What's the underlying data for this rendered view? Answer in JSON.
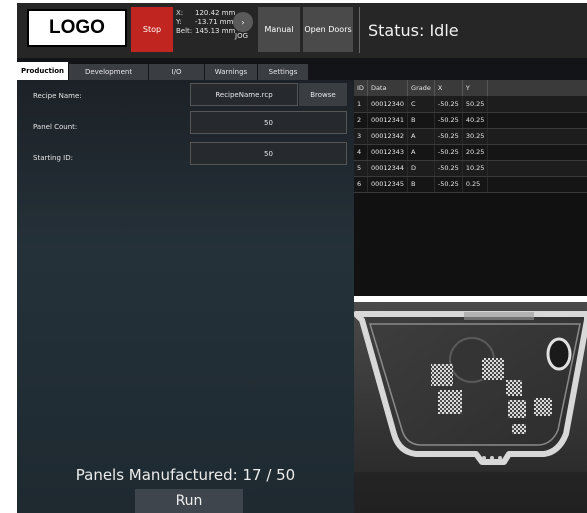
{
  "header": {
    "logo": "LOGO",
    "stop_label": "Stop",
    "coords": [
      {
        "axis": "X:",
        "value": "120.42 mm"
      },
      {
        "axis": "Y:",
        "value": "-13.71 mm"
      },
      {
        "axis": "Belt:",
        "value": "145.13 mm"
      }
    ],
    "jog_label": "JOG",
    "manual_label": "Manual",
    "open_doors_label": "Open Doors",
    "status": "Status: Idle"
  },
  "tabs": [
    {
      "label": "Production",
      "active": true
    },
    {
      "label": "Development",
      "active": false
    },
    {
      "label": "I/O",
      "active": false
    },
    {
      "label": "Warnings",
      "active": false
    },
    {
      "label": "Settings",
      "active": false
    }
  ],
  "form": {
    "recipe_label": "Recipe Name:",
    "recipe_value": "RecipeName.rcp",
    "browse_label": "Browse",
    "panel_count_label": "Panel Count:",
    "panel_count_value": "50",
    "starting_id_label": "Starting ID:",
    "starting_id_value": "50"
  },
  "production": {
    "manufactured_text": "Panels Manufactured: 17 / 50",
    "run_label": "Run"
  },
  "table": {
    "columns": [
      "ID",
      "Data",
      "Grade",
      "X",
      "Y"
    ],
    "rows": [
      [
        "1",
        "00012340",
        "C",
        "-50.25",
        "50.25"
      ],
      [
        "2",
        "00012341",
        "B",
        "-50.25",
        "40.25"
      ],
      [
        "3",
        "00012342",
        "A",
        "-50.25",
        "30.25"
      ],
      [
        "4",
        "00012343",
        "A",
        "-50.25",
        "20.25"
      ],
      [
        "5",
        "00012344",
        "D",
        "-50.25",
        "10.25"
      ],
      [
        "6",
        "00012345",
        "B",
        "-50.25",
        "0.25"
      ]
    ]
  },
  "colors": {
    "stop": "#c0251f",
    "header_bg": "#262626",
    "panel_bg": "#253139"
  }
}
